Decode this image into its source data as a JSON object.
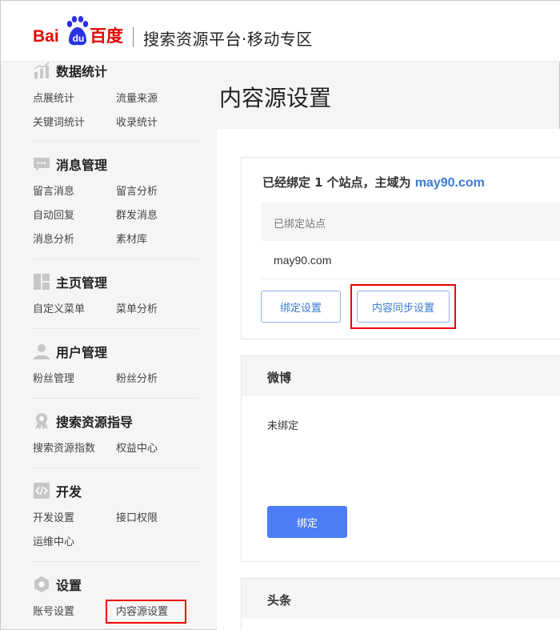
{
  "header": {
    "logo": {
      "bai": "Bai",
      "du": "du",
      "baidu_cn": "百度"
    },
    "title": "搜索资源平台·移动专区"
  },
  "sidebar": {
    "groups": [
      {
        "title": "数据统计",
        "icon": "bar-chart-icon",
        "links": [
          "点展统计",
          "流量来源",
          "关键词统计",
          "收录统计"
        ]
      },
      {
        "title": "消息管理",
        "icon": "chat-bubble-icon",
        "links": [
          "留言消息",
          "留言分析",
          "自动回复",
          "群发消息",
          "消息分析",
          "素材库"
        ]
      },
      {
        "title": "主页管理",
        "icon": "layout-icon",
        "links": [
          "自定义菜单",
          "菜单分析"
        ]
      },
      {
        "title": "用户管理",
        "icon": "user-icon",
        "links": [
          "粉丝管理",
          "粉丝分析"
        ]
      },
      {
        "title": "搜索资源指导",
        "icon": "award-icon",
        "links": [
          "搜索资源指数",
          "权益中心"
        ]
      },
      {
        "title": "开发",
        "icon": "code-icon",
        "links": [
          "开发设置",
          "接口权限",
          "运维中心"
        ]
      },
      {
        "title": "设置",
        "icon": "hexagon-settings-icon",
        "links": [
          "账号设置",
          "内容源设置"
        ]
      }
    ],
    "active": "内容源设置"
  },
  "main": {
    "page_title": "内容源设置",
    "bound_site": {
      "prefix": "已经绑定",
      "count": "1",
      "middle": "个站点，主域为",
      "domain": "may90.com",
      "table_header": "已绑定站点",
      "rows": [
        "may90.com"
      ],
      "btn_bind_settings": "绑定设置",
      "btn_sync_settings": "内容同步设置"
    },
    "weibo": {
      "title": "微博",
      "status": "未绑定",
      "btn_bind": "绑定"
    },
    "toutiao": {
      "title": "头条"
    }
  },
  "colors": {
    "brand_red": "#e10601",
    "brand_blue": "#2932e1",
    "link_blue": "#3a7bd5",
    "primary": "#4d7ef7",
    "highlight": "#ee0000"
  }
}
